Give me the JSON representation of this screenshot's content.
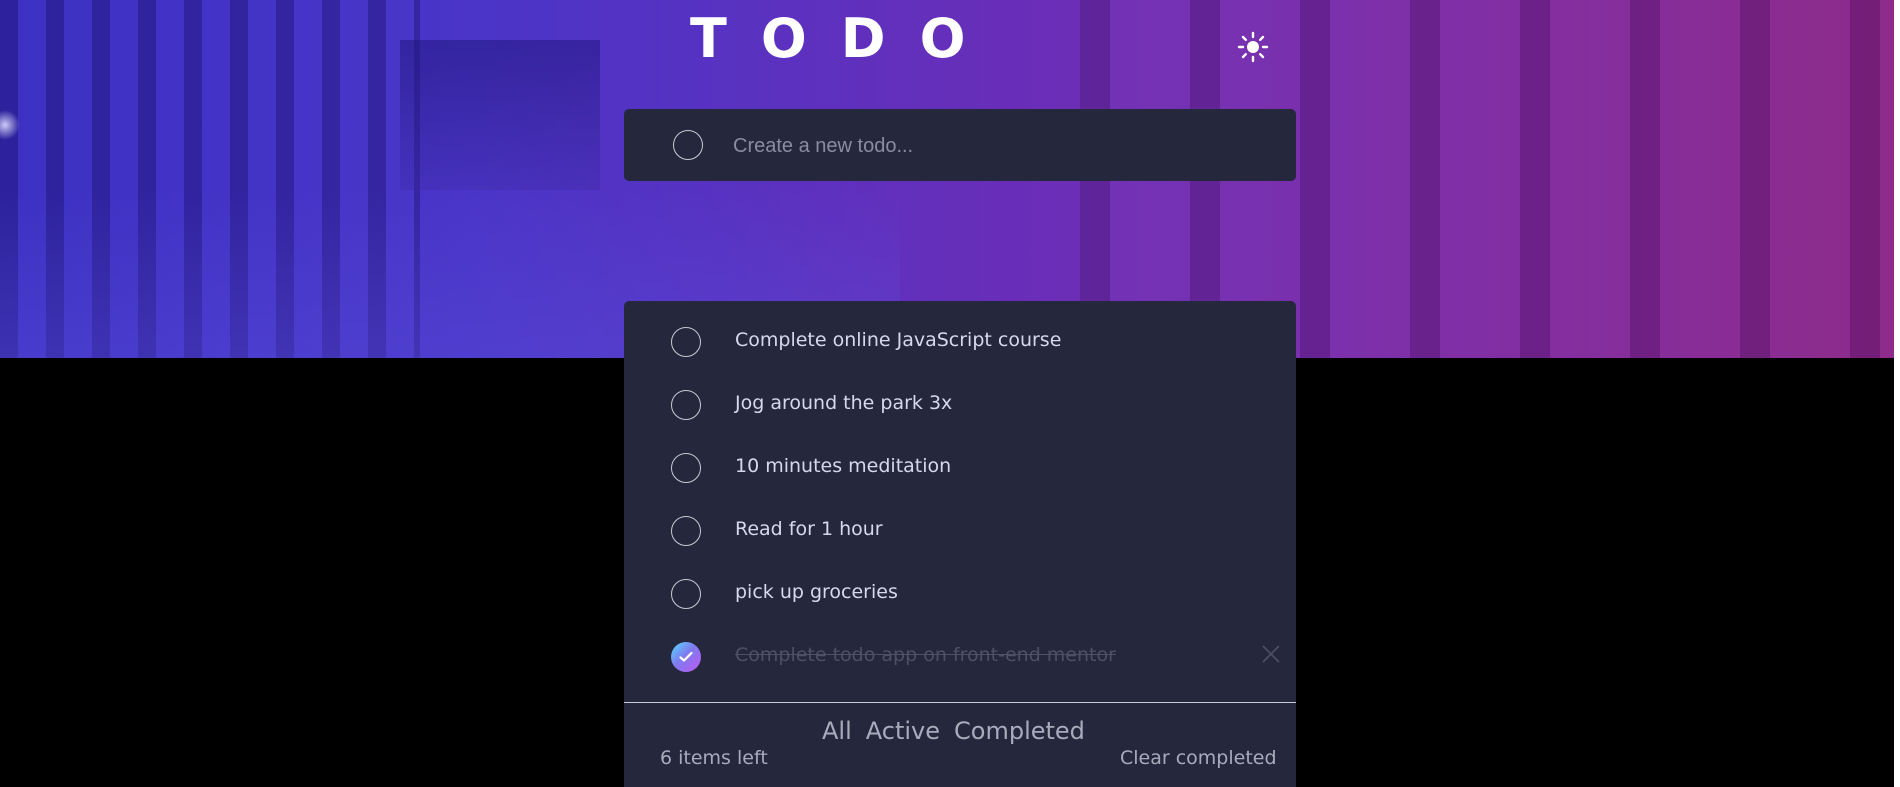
{
  "header": {
    "title": "TODO",
    "theme_icon": "sun-icon"
  },
  "new_todo": {
    "placeholder": "Create a new todo..."
  },
  "todos": [
    {
      "text": "Complete online JavaScript course",
      "completed": false
    },
    {
      "text": "Jog around the park 3x",
      "completed": false
    },
    {
      "text": "10 minutes meditation",
      "completed": false
    },
    {
      "text": "Read for 1 hour",
      "completed": false
    },
    {
      "text": "pick up groceries",
      "completed": false
    },
    {
      "text": "Complete todo app on front-end mentor",
      "completed": true
    }
  ],
  "footer": {
    "items_left": "6 items left",
    "filters": [
      "All",
      "Active",
      "Completed"
    ],
    "clear_label": "Clear completed"
  },
  "colors": {
    "card_bg": "#25273c",
    "text": "#d6d8ee",
    "muted": "#a9abbd",
    "check_gradient_start": "#57ddff",
    "check_gradient_end": "#c058f3"
  }
}
